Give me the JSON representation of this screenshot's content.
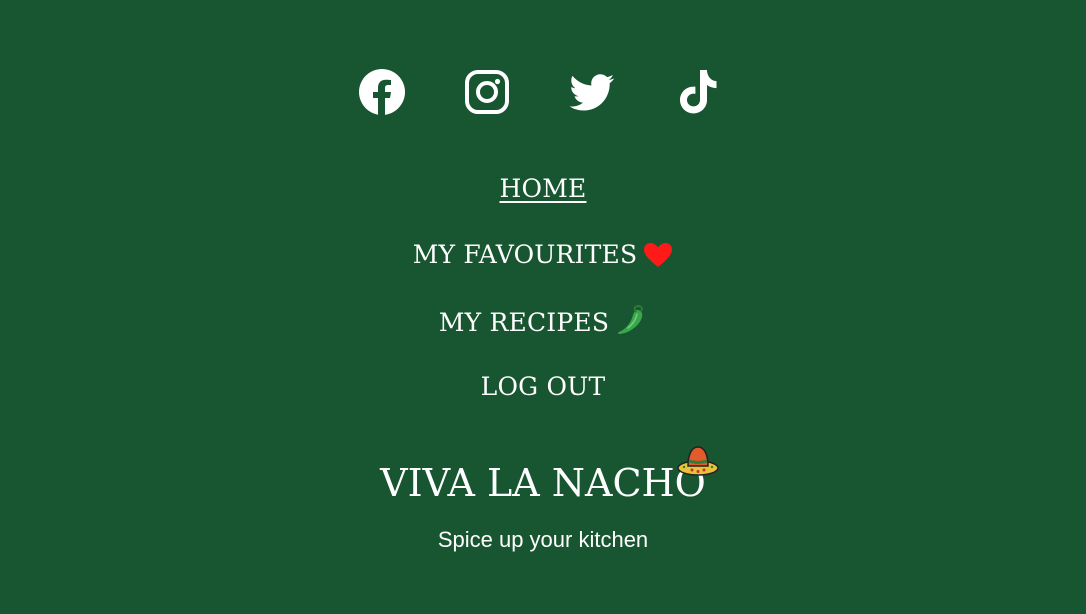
{
  "social": {
    "icons": [
      "facebook-icon",
      "instagram-icon",
      "twitter-icon",
      "tiktok-icon"
    ]
  },
  "nav": {
    "home": "HOME",
    "favourites": "MY FAVOURITES",
    "favourites_emoji": "heart-icon",
    "recipes": "MY RECIPES",
    "recipes_emoji": "chili-pepper-icon",
    "logout": "LOG OUT"
  },
  "brand": {
    "title": "VIVA LA NACHO",
    "emoji": "sombrero-icon",
    "tagline": "Spice up your kitchen"
  },
  "colors": {
    "background": "#185531",
    "text": "#ffffff",
    "heart": "#ff1a1a",
    "chili": "#3aa64a"
  }
}
